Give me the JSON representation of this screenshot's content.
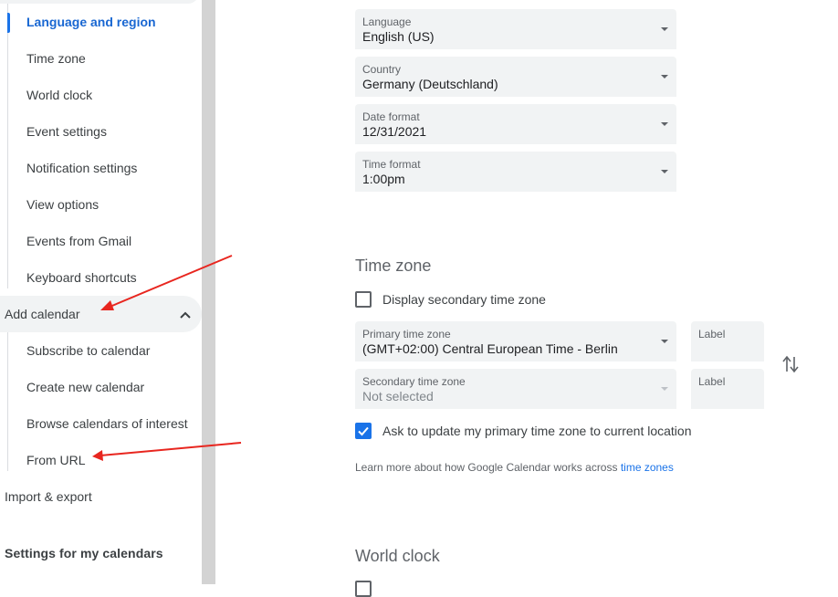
{
  "sidebar": {
    "active_item": "Language and region",
    "sub_items_general": [
      "Time zone",
      "World clock",
      "Event settings",
      "Notification settings",
      "View options",
      "Events from Gmail",
      "Keyboard shortcuts"
    ],
    "add_calendar": "Add calendar",
    "add_calendar_items": [
      "Subscribe to calendar",
      "Create new calendar",
      "Browse calendars of interest",
      "From URL"
    ],
    "import_export": "Import & export",
    "settings_heading": "Settings for my calendars"
  },
  "language_region": {
    "language": {
      "label": "Language",
      "value": "English (US)"
    },
    "country": {
      "label": "Country",
      "value": "Germany (Deutschland)"
    },
    "date_format": {
      "label": "Date format",
      "value": "12/31/2021"
    },
    "time_format": {
      "label": "Time format",
      "value": "1:00pm"
    }
  },
  "time_zone": {
    "title": "Time zone",
    "secondary_checkbox_label": "Display secondary time zone",
    "secondary_checked": false,
    "primary": {
      "label": "Primary time zone",
      "value": "(GMT+02:00) Central European Time - Berlin"
    },
    "primary_label_field": "Label",
    "secondary": {
      "label": "Secondary time zone",
      "value": "Not selected"
    },
    "secondary_label_field": "Label",
    "ask_update_label": "Ask to update my primary time zone to current location",
    "ask_update_checked": true,
    "learn_more_text": "Learn more about how Google Calendar works across",
    "learn_more_link": "time zones"
  },
  "world_clock": {
    "title": "World clock"
  },
  "colors": {
    "accent": "#1a73e8",
    "field_bg": "#f1f3f4",
    "annotation_arrow": "#e8261f"
  },
  "icons": [
    "chevron-up-icon",
    "dropdown-caret-icon",
    "swap-vertical-icon",
    "check-icon"
  ]
}
